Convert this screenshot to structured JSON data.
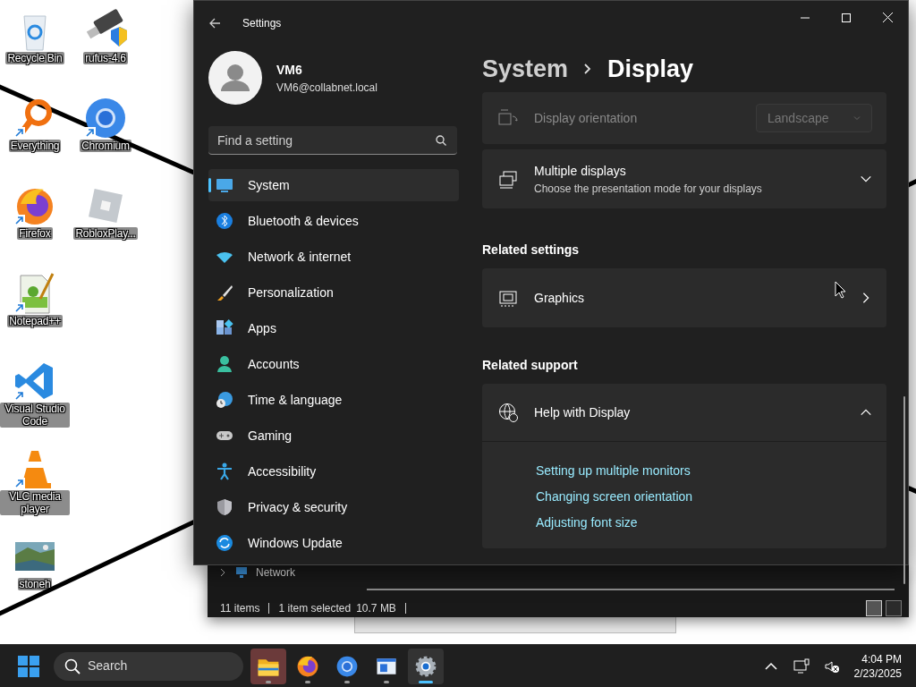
{
  "desktop": {
    "columns": [
      [
        {
          "label": "Recycle Bin",
          "shortcut": false
        },
        {
          "label": "Everything",
          "shortcut": true
        },
        {
          "label": "Firefox",
          "shortcut": true
        },
        {
          "label": "Notepad++",
          "shortcut": true
        },
        {
          "label": "Visual Studio Code",
          "shortcut": true
        },
        {
          "label": "VLC media player",
          "shortcut": true
        },
        {
          "label": "stoneh",
          "shortcut": false
        }
      ],
      [
        {
          "label": "rufus-4.6",
          "shortcut": false
        },
        {
          "label": "Chromium",
          "shortcut": true
        },
        {
          "label": "RobloxPlay...",
          "shortcut": false
        }
      ]
    ]
  },
  "settings_window": {
    "title": "Settings",
    "user": {
      "name": "VM6",
      "email": "VM6@collabnet.local"
    },
    "search": {
      "placeholder": "Find a setting"
    },
    "nav": [
      {
        "label": "System",
        "selected": true
      },
      {
        "label": "Bluetooth & devices",
        "selected": false
      },
      {
        "label": "Network & internet",
        "selected": false
      },
      {
        "label": "Personalization",
        "selected": false
      },
      {
        "label": "Apps",
        "selected": false
      },
      {
        "label": "Accounts",
        "selected": false
      },
      {
        "label": "Time & language",
        "selected": false
      },
      {
        "label": "Gaming",
        "selected": false
      },
      {
        "label": "Accessibility",
        "selected": false
      },
      {
        "label": "Privacy & security",
        "selected": false
      },
      {
        "label": "Windows Update",
        "selected": false
      }
    ],
    "breadcrumb": [
      "System",
      "Display"
    ],
    "cards": [
      {
        "kind": "dropdown",
        "title": "Display orientation",
        "value": "Landscape",
        "disabled": true
      },
      {
        "kind": "expander",
        "title": "Multiple displays",
        "subtitle": "Choose the presentation mode for your displays",
        "expanded": false
      }
    ],
    "sections": [
      {
        "heading": "Related settings",
        "cards": [
          {
            "kind": "link",
            "title": "Graphics"
          }
        ]
      },
      {
        "heading": "Related support",
        "cards": [
          {
            "kind": "expander",
            "title": "Help with Display",
            "expanded": true,
            "links": [
              "Setting up multiple monitors",
              "Changing screen orientation",
              "Adjusting font size"
            ]
          }
        ]
      }
    ]
  },
  "explorer_window": {
    "tree_item": "Network",
    "status": [
      "11 items",
      "1 item selected",
      "10.7 MB"
    ],
    "views": [
      {
        "selected": true
      },
      {
        "selected": false
      }
    ]
  },
  "taskbar": {
    "search": "Search",
    "apps": [
      {
        "selected": false,
        "running": true,
        "highlighted": true
      },
      {
        "selected": false,
        "running": true,
        "highlighted": false
      },
      {
        "selected": false,
        "running": true,
        "highlighted": false
      },
      {
        "selected": false,
        "running": true,
        "highlighted": false
      },
      {
        "selected": true,
        "running": true,
        "highlighted": false
      }
    ],
    "time": "4:04 PM",
    "date": "2/23/2025"
  }
}
